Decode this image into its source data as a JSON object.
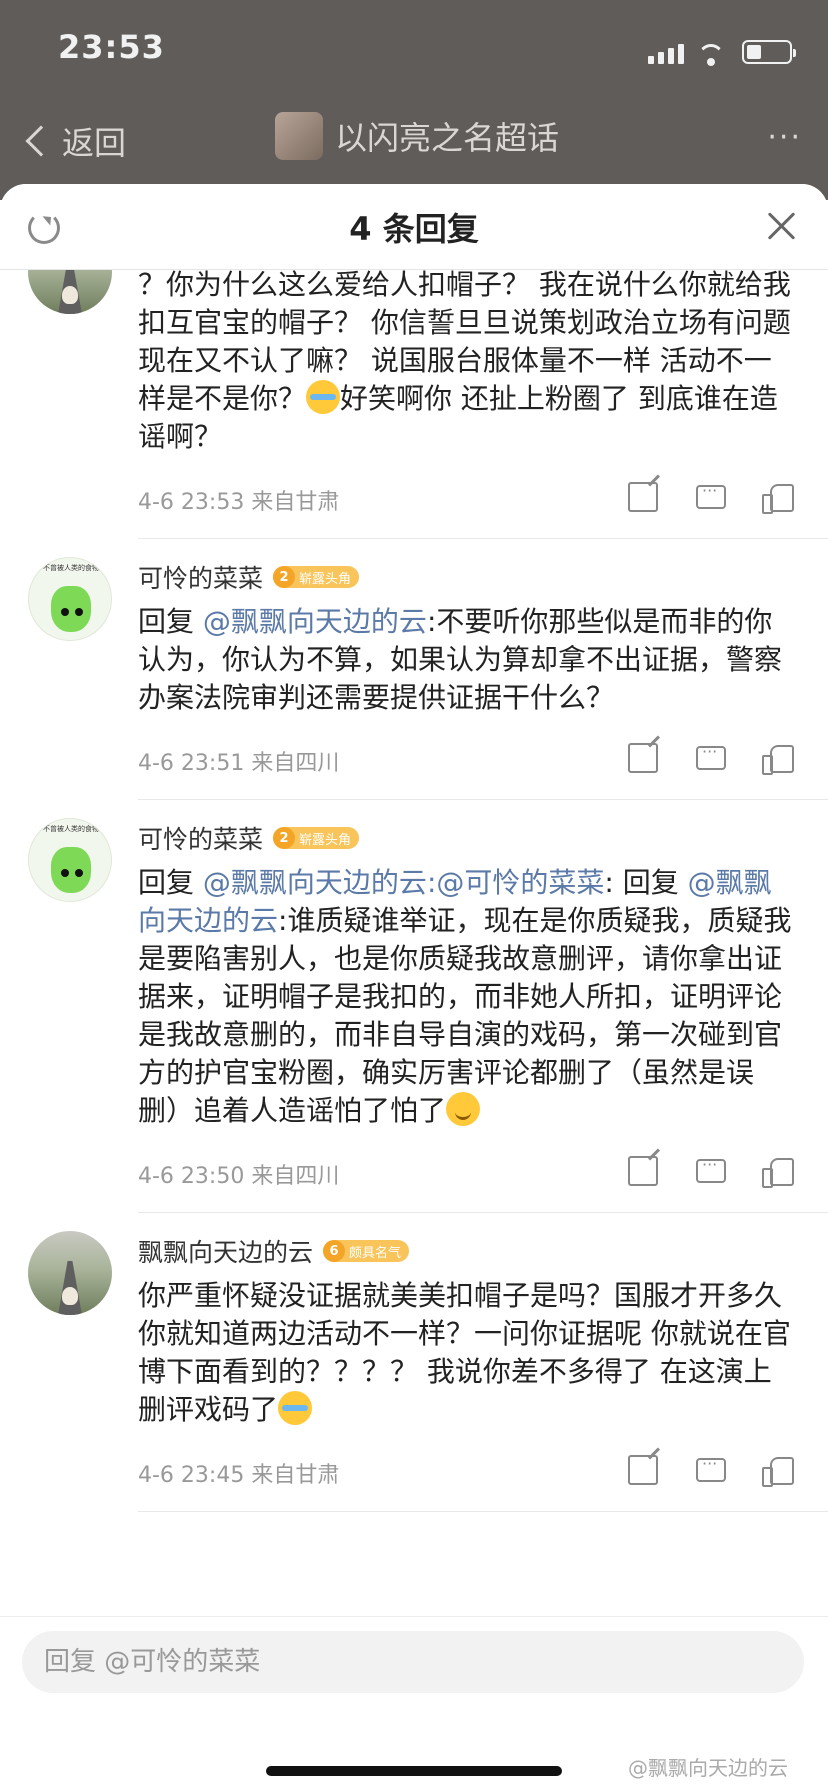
{
  "status_bar": {
    "time": "23:53"
  },
  "nav": {
    "back_label": "返回",
    "title": "以闪亮之名超话",
    "more": "···"
  },
  "sheet": {
    "title": "4 条回复"
  },
  "comments": [
    {
      "name": "",
      "text_parts": [
        "？你为什么这么爱给人扣帽子？ 我在说什么你就给我扣互官宝的帽子？ 你信誓旦旦说策划政治立场有问题现在又不认了嘛？ 说国服台服体量不一样 活动不一样是不是你？",
        "好笑啊你 还扯上粉圈了 到底谁在造谣啊？"
      ],
      "date": "4-6 23:53",
      "location": "来自甘肃"
    },
    {
      "name": "可怜的菜菜",
      "badge_level": "2",
      "badge_text": "崭露头角",
      "reply_prefix": "回复",
      "mention": "@飘飘向天边的云",
      "text": ":不要听你那些似是而非的你认为，你认为不算，如果认为算却拿不出证据，警察办案法院审判还需要提供证据干什么？",
      "date": "4-6 23:51",
      "location": "来自四川"
    },
    {
      "name": "可怜的菜菜",
      "badge_level": "2",
      "badge_text": "崭露头角",
      "reply_prefix": "回复",
      "mention": "@飘飘向天边的云",
      "mention2": ":@可怜的菜菜",
      "mid": ": 回复 ",
      "mention3": "@飘飘向天边的云",
      "text": ":谁质疑谁举证，现在是你质疑我，质疑我是要陷害别人，也是你质疑我故意删评，请你拿出证据来，证明帽子是我扣的，而非她人所扣，证明评论是我故意删的，而非自导自演的戏码，第一次碰到官方的护官宝粉圈，确实厉害评论都删了（虽然是误删）追着人造谣怕了怕了",
      "date": "4-6 23:50",
      "location": "来自四川"
    },
    {
      "name": "飘飘向天边的云",
      "badge_level": "6",
      "badge_text": "颇具名气",
      "text": "你严重怀疑没证据就美美扣帽子是吗？国服才开多久你就知道两边活动不一样？一问你证据呢 你就说在官博下面看到的？？？？ 我说你差不多得了  在这演上删评戏码了",
      "date": "4-6 23:45",
      "location": "来自甘肃"
    }
  ],
  "avatar_caption": "不曾被人类的食物",
  "reply_bar": {
    "placeholder": "回复 @可怜的菜菜"
  },
  "watermark": "@飘飘向天边的云",
  "colors": {
    "link": "#5b7aa8",
    "badge": "#f9c45a",
    "meta": "#999999"
  }
}
